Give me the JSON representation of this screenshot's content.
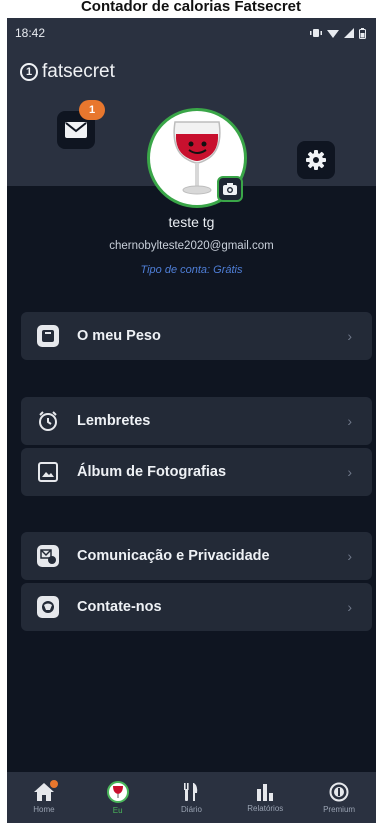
{
  "caption": "Contador de calorias Fatsecret",
  "status_bar": {
    "time": "18:42"
  },
  "brand": {
    "name": "fatsecret",
    "logo_glyph": "1"
  },
  "messages": {
    "badge_count": "1"
  },
  "profile": {
    "name": "teste tg",
    "email": "chernobylteste2020@gmail.com",
    "account_type": "Tipo de conta: Grátis"
  },
  "menu": {
    "weight": "O meu Peso",
    "reminders": "Lembretes",
    "photo_album": "Álbum de Fotografias",
    "communication": "Comunicação e Privacidade",
    "contact": "Contate-nos",
    "chevron": "›"
  },
  "bottom_nav": {
    "home": "Home",
    "me": "Eu",
    "diary": "Diário",
    "reports": "Relatórios",
    "premium": "Premium"
  },
  "colors": {
    "accent_green": "#3aa648",
    "badge_orange": "#e8772e",
    "background": "#0f1521",
    "header": "#2a3140",
    "link_blue": "#4f7fd8"
  }
}
